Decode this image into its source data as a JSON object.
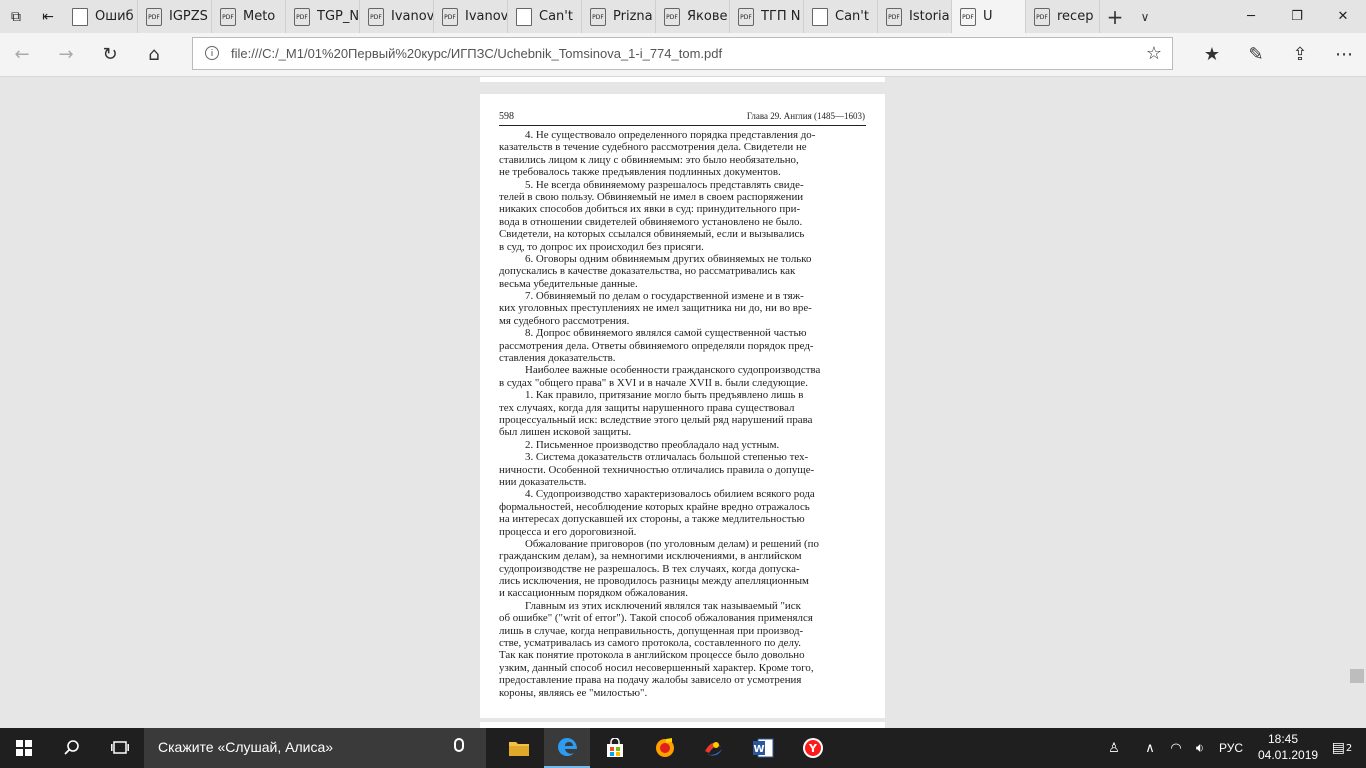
{
  "browser": {
    "tabs": [
      {
        "label": "Ошиб",
        "icon": "doc-icon",
        "type": "doc"
      },
      {
        "label": "IGPZS",
        "icon": "pdf-icon",
        "type": "pdf"
      },
      {
        "label": "Meto",
        "icon": "pdf-icon",
        "type": "pdf"
      },
      {
        "label": "TGP_N",
        "icon": "pdf-icon",
        "type": "pdf"
      },
      {
        "label": "Ivanov",
        "icon": "pdf-icon",
        "type": "pdf"
      },
      {
        "label": "Ivanov",
        "icon": "pdf-icon",
        "type": "pdf"
      },
      {
        "label": "Can't",
        "icon": "doc-icon",
        "type": "doc"
      },
      {
        "label": "Prizna",
        "icon": "pdf-icon",
        "type": "pdf"
      },
      {
        "label": "Якове",
        "icon": "pdf-icon",
        "type": "pdf"
      },
      {
        "label": "ТГП N",
        "icon": "pdf-icon",
        "type": "pdf"
      },
      {
        "label": "Can't",
        "icon": "doc-icon",
        "type": "doc"
      },
      {
        "label": "Istoria",
        "icon": "pdf-icon",
        "type": "pdf"
      },
      {
        "label": "U",
        "icon": "pdf-icon",
        "type": "pdf",
        "active": true
      },
      {
        "label": "recep",
        "icon": "pdf-icon",
        "type": "pdf"
      }
    ],
    "address": "file:///C:/_M1/01%20Первый%20курс/ИГПЗС/Uchebnik_Tomsinova_1-i_774_tom.pdf"
  },
  "document": {
    "page_number": "598",
    "running_head": "Глава 29. Англия (1485—1603)",
    "lines": [
      {
        "text": "4. Не существовало определенного порядка представления до-",
        "indent": true
      },
      {
        "text": "казательств в течение судебного рассмотрения дела. Свидетели не",
        "indent": false
      },
      {
        "text": "ставились лицом к лицу с обвиняемым: это было необязательно,",
        "indent": false
      },
      {
        "text": "не требовалось также предъявления подлинных документов.",
        "indent": false
      },
      {
        "text": "5. Не всегда обвиняемому разрешалось представлять свиде-",
        "indent": true
      },
      {
        "text": "телей в свою пользу. Обвиняемый не имел в своем распоряжении",
        "indent": false
      },
      {
        "text": "никаких способов добиться их явки в суд: принудительного при-",
        "indent": false
      },
      {
        "text": "вода в отношении свидетелей обвиняемого установлено не было.",
        "indent": false
      },
      {
        "text": "Свидетели, на которых ссылался обвиняемый, если и вызывались",
        "indent": false
      },
      {
        "text": "в суд, то допрос их происходил без присяги.",
        "indent": false
      },
      {
        "text": "6. Оговоры одним обвиняемым других обвиняемых не только",
        "indent": true
      },
      {
        "text": "допускались в качестве доказательства, но рассматривались как",
        "indent": false
      },
      {
        "text": "весьма убедительные данные.",
        "indent": false
      },
      {
        "text": "7. Обвиняемый по делам о государственной измене и в тяж-",
        "indent": true
      },
      {
        "text": "ких уголовных преступлениях не имел защитника ни до, ни во вре-",
        "indent": false
      },
      {
        "text": "мя судебного рассмотрения.",
        "indent": false
      },
      {
        "text": "8. Допрос обвиняемого являлся самой существенной частью",
        "indent": true
      },
      {
        "text": "рассмотрения дела. Ответы обвиняемого определяли порядок пред-",
        "indent": false
      },
      {
        "text": "ставления доказательств.",
        "indent": false
      },
      {
        "text": "Наиболее важные особенности гражданского судопроизводства",
        "indent": true
      },
      {
        "text": "в судах \"общего права\" в XVI и в начале XVII в. были следующие.",
        "indent": false
      },
      {
        "text": "1. Как правило, притязание могло быть предъявлено лишь в",
        "indent": true
      },
      {
        "text": "тех случаях, когда для защиты нарушенного права существовал",
        "indent": false
      },
      {
        "text": "процессуальный иск: вследствие этого целый ряд нарушений права",
        "indent": false
      },
      {
        "text": "был лишен исковой защиты.",
        "indent": false
      },
      {
        "text": "2. Письменное производство преобладало над устным.",
        "indent": true
      },
      {
        "text": "3. Система доказательств отличалась большой степенью тех-",
        "indent": true
      },
      {
        "text": "ничности. Особенной техничностью отличались правила о допуще-",
        "indent": false
      },
      {
        "text": "нии доказательств.",
        "indent": false
      },
      {
        "text": "4. Судопроизводство характеризовалось обилием всякого рода",
        "indent": true
      },
      {
        "text": "формальностей, несоблюдение которых крайне вредно отражалось",
        "indent": false
      },
      {
        "text": "на интересах допускавшей их стороны, а также медлительностью",
        "indent": false
      },
      {
        "text": "процесса и его дороговизной.",
        "indent": false
      },
      {
        "text": "Обжалование приговоров (по уголовным делам) и решений (по",
        "indent": true
      },
      {
        "text": "гражданским делам), за немногими исключениями, в английском",
        "indent": false
      },
      {
        "text": "судопроизводстве не разрешалось. В тех случаях, когда допуска-",
        "indent": false
      },
      {
        "text": "лись исключения, не проводилось разницы между апелляционным",
        "indent": false
      },
      {
        "text": "и кассационным порядком обжалования.",
        "indent": false
      },
      {
        "text": "Главным из этих исключений являлся так называемый \"иск",
        "indent": true
      },
      {
        "text": "об ошибке\" (\"writ of error\"). Такой способ обжалования применялся",
        "indent": false
      },
      {
        "text": "лишь в случае, когда неправильность, допущенная при производ-",
        "indent": false
      },
      {
        "text": "стве, усматривалась из самого протокола, составленного по делу.",
        "indent": false
      },
      {
        "text": "Так как понятие протокола в английском процессе было довольно",
        "indent": false
      },
      {
        "text": "узким, данный способ носил несовершенный характер. Кроме того,",
        "indent": false
      },
      {
        "text": "предоставление права на подачу жалобы зависело от усмотрения",
        "indent": false
      },
      {
        "text": "короны, являясь ее \"милостью\".",
        "indent": false
      }
    ]
  },
  "taskbar": {
    "search_placeholder": "Скажите «Слушай, Алиса»",
    "language": "РУС",
    "time": "18:45",
    "date": "04.01.2019",
    "notification_count": "2"
  },
  "colors": {
    "taskbar": "#1f1f1f",
    "viewer_bg": "#e6e6e6",
    "edge_blue": "#0078d7",
    "yandex_red": "#ff0000"
  }
}
